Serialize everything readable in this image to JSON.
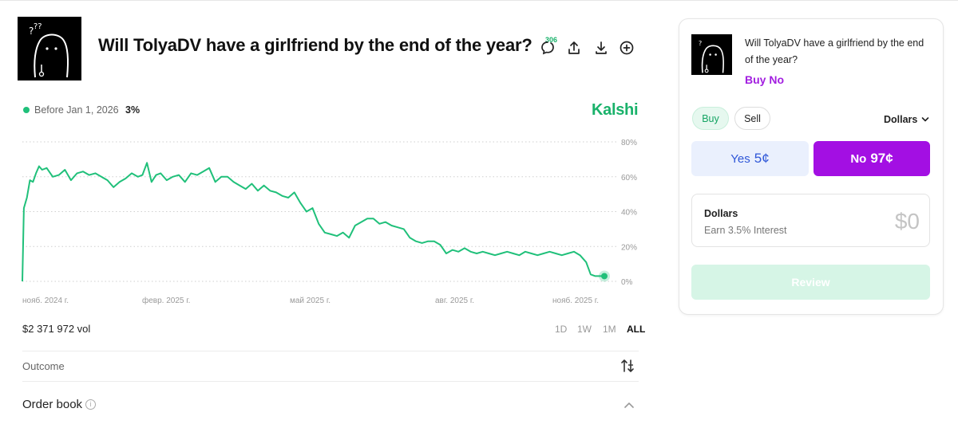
{
  "market": {
    "title": "Will TolyaDV have a girlfriend by the end of the year?",
    "comment_count": "306"
  },
  "chart_header": {
    "legend_label": "Before Jan 1, 2026",
    "legend_value": "3%",
    "brand": "Kalshi"
  },
  "chart_data": {
    "type": "line",
    "series": [
      {
        "name": "Before Jan 1, 2026",
        "color": "#20c07a",
        "x": [
          "2024-10-25",
          "2024-10-26",
          "2024-10-28",
          "2024-10-30",
          "2024-11-01",
          "2024-11-03",
          "2024-11-05",
          "2024-11-07",
          "2024-11-10",
          "2024-11-14",
          "2024-11-18",
          "2024-11-22",
          "2024-11-26",
          "2024-11-30",
          "2024-12-04",
          "2024-12-08",
          "2024-12-12",
          "2024-12-16",
          "2024-12-20",
          "2024-12-24",
          "2024-12-28",
          "2025-01-01",
          "2025-01-05",
          "2025-01-09",
          "2025-01-12",
          "2025-01-15",
          "2025-01-18",
          "2025-01-21",
          "2025-01-24",
          "2025-01-28",
          "2025-02-01",
          "2025-02-05",
          "2025-02-09",
          "2025-02-13",
          "2025-02-17",
          "2025-02-21",
          "2025-02-25",
          "2025-03-01",
          "2025-03-05",
          "2025-03-09",
          "2025-03-13",
          "2025-03-17",
          "2025-03-21",
          "2025-03-25",
          "2025-03-29",
          "2025-04-02",
          "2025-04-06",
          "2025-04-10",
          "2025-04-14",
          "2025-04-18",
          "2025-04-22",
          "2025-04-26",
          "2025-04-30",
          "2025-05-04",
          "2025-05-08",
          "2025-05-12",
          "2025-05-16",
          "2025-05-20",
          "2025-05-24",
          "2025-05-28",
          "2025-06-01",
          "2025-06-05",
          "2025-06-09",
          "2025-06-13",
          "2025-06-17",
          "2025-06-21",
          "2025-06-25",
          "2025-06-29",
          "2025-07-03",
          "2025-07-07",
          "2025-07-11",
          "2025-07-15",
          "2025-07-19",
          "2025-07-23",
          "2025-07-27",
          "2025-07-31",
          "2025-08-04",
          "2025-08-08",
          "2025-08-12",
          "2025-08-16",
          "2025-08-20",
          "2025-08-24",
          "2025-08-28",
          "2025-09-01",
          "2025-09-05",
          "2025-09-09",
          "2025-09-13",
          "2025-09-17",
          "2025-09-21",
          "2025-09-25",
          "2025-09-29",
          "2025-10-03",
          "2025-10-07",
          "2025-10-11",
          "2025-10-15",
          "2025-10-19",
          "2025-10-23",
          "2025-10-27",
          "2025-10-31",
          "2025-11-03",
          "2025-11-06",
          "2025-11-09",
          "2025-11-12"
        ],
        "y": [
          0,
          42,
          48,
          58,
          57,
          62,
          66,
          64,
          65,
          60,
          61,
          64,
          58,
          62,
          63,
          61,
          62,
          60,
          58,
          54,
          57,
          59,
          62,
          60,
          61,
          68,
          57,
          61,
          62,
          58,
          60,
          61,
          57,
          62,
          61,
          63,
          65,
          57,
          60,
          60,
          57,
          55,
          53,
          56,
          52,
          55,
          52,
          51,
          49,
          48,
          51,
          45,
          40,
          42,
          33,
          28,
          27,
          26,
          28,
          25,
          32,
          34,
          36,
          36,
          33,
          34,
          32,
          31,
          30,
          25,
          23,
          22,
          23,
          23,
          21,
          16,
          18,
          17,
          19,
          17,
          16,
          17,
          16,
          15,
          16,
          17,
          16,
          15,
          17,
          16,
          15,
          16,
          17,
          16,
          15,
          16,
          17,
          15,
          11,
          4,
          3,
          3,
          3
        ]
      }
    ],
    "x_ticks": [
      "нояб. 2024 г.",
      "февр. 2025 г.",
      "май 2025 г.",
      "авг. 2025 г.",
      "нояб. 2025 г."
    ],
    "y_ticks": [
      "80%",
      "60%",
      "40%",
      "20%",
      "0%"
    ],
    "ylim": [
      0,
      80
    ],
    "grid": true,
    "grid_style": "dotted",
    "current_value": 3
  },
  "volume": "$2 371 972 vol",
  "ranges": [
    "1D",
    "1W",
    "1M",
    "ALL"
  ],
  "active_range": "ALL",
  "outcome_label": "Outcome",
  "orderbook_label": "Order book",
  "info_glyph": "i",
  "panel": {
    "title": "Will TolyaDV have a girlfriend by the end of the year?",
    "action": "Buy No",
    "tab_buy": "Buy",
    "tab_sell": "Sell",
    "currency": "Dollars",
    "yes_label": "Yes",
    "yes_price": "5¢",
    "no_label": "No",
    "no_price": "97¢",
    "amount_label": "Dollars",
    "amount_sub": "Earn 3.5% Interest",
    "amount_value": "$0",
    "review": "Review"
  },
  "colors": {
    "accent_green": "#1ab26b",
    "chart_line": "#20c07a",
    "no_purple": "#a30fe3",
    "yes_blue": "#2f57d8"
  },
  "icons": [
    "comments-icon",
    "share-icon",
    "download-icon",
    "add-circle-icon",
    "sort-icon",
    "info-icon",
    "chevron-up-icon",
    "chevron-down-icon"
  ]
}
